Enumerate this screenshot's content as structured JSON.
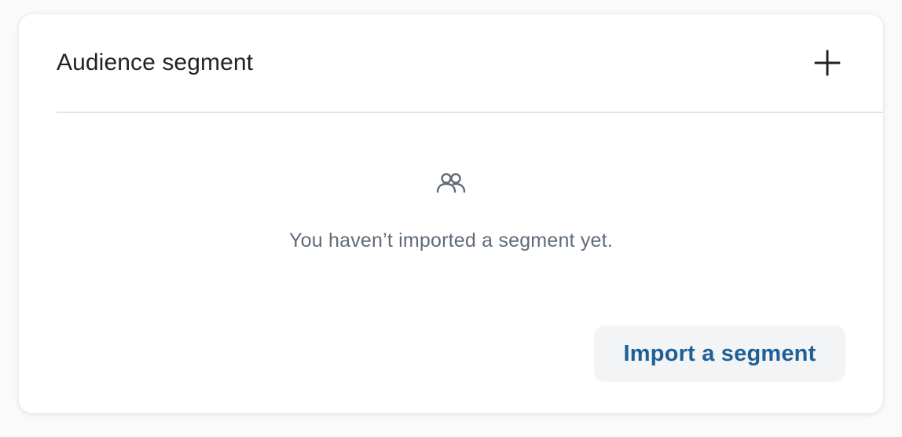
{
  "card": {
    "title": "Audience segment",
    "empty_message": "You haven’t imported a segment yet.",
    "import_button_label": "Import a segment"
  },
  "icons": {
    "add": "plus-icon",
    "empty_state": "people-icon"
  },
  "colors": {
    "title": "#1f2328",
    "empty_text": "#5f6b78",
    "button_text": "#1f5f96",
    "button_bg": "#f3f4f5",
    "divider": "#e3e4e6"
  }
}
